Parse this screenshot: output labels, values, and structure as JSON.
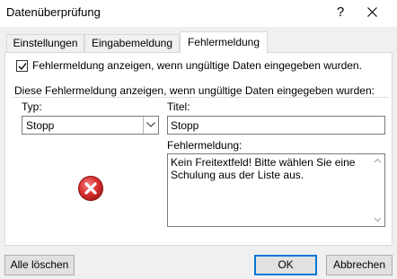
{
  "window": {
    "title": "Datenüberprüfung",
    "help_glyph": "?"
  },
  "tabs": [
    {
      "label": "Einstellungen",
      "active": false
    },
    {
      "label": "Eingabemeldung",
      "active": false
    },
    {
      "label": "Fehlermeldung",
      "active": true
    }
  ],
  "panel": {
    "show_error_checkbox": {
      "checked": true,
      "label": "Fehlermeldung anzeigen, wenn ungültige Daten eingegeben wurden."
    },
    "section_label": "Diese Fehlermeldung anzeigen, wenn ungültige Daten eingegeben wurden:",
    "style": {
      "label": "Typ:",
      "value": "Stopp",
      "icon": "error-stop-icon"
    },
    "title_field": {
      "label": "Titel:",
      "value": "Stopp"
    },
    "message_field": {
      "label": "Fehlermeldung:",
      "value": "Kein Freitextfeld! Bitte wählen Sie eine Schulung aus der Liste aus."
    }
  },
  "buttons": {
    "clear_all": "Alle löschen",
    "ok": "OK",
    "cancel": "Abbrechen"
  },
  "colors": {
    "accent": "#0078d7",
    "error_red": "#d32f2f"
  }
}
